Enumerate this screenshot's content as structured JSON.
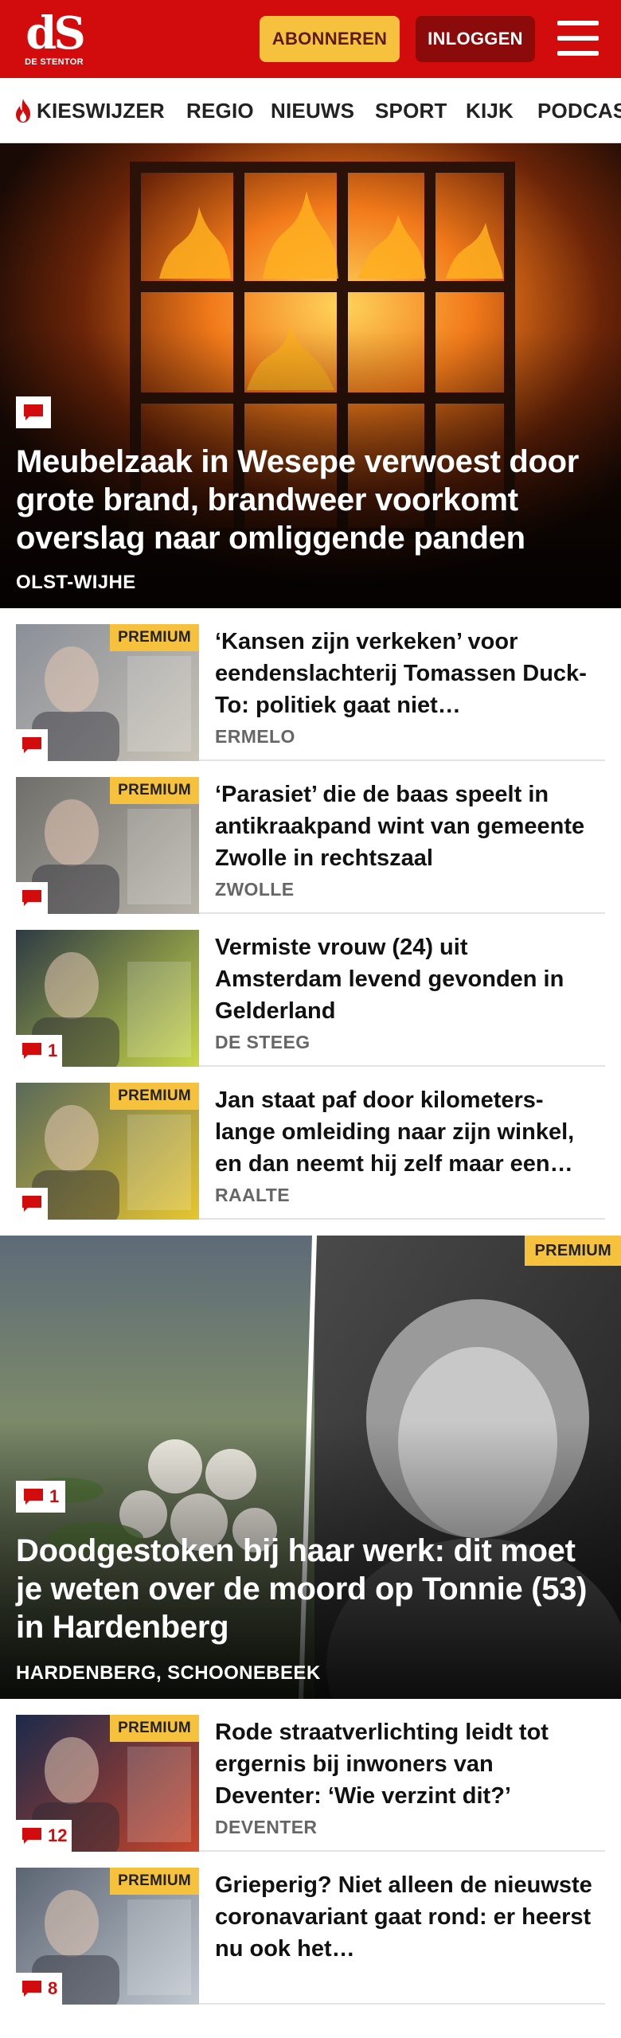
{
  "header": {
    "logo_mark": "dS",
    "logo_sub": "DE STENTOR",
    "subscribe_label": "ABONNEREN",
    "login_label": "INLOGGEN",
    "brand_color": "#d20c0c",
    "accent_color": "#f6c23e"
  },
  "nav": {
    "items": [
      {
        "label": "KIESWIJZER",
        "icon": "flame-icon"
      },
      {
        "label": "REGIO"
      },
      {
        "label": "NIEUWS"
      },
      {
        "label": "SPORT"
      },
      {
        "label": "KIJK"
      },
      {
        "label": "PODCASTS"
      }
    ]
  },
  "hero1": {
    "title": "Meubelzaak in Wesepe verwoest door grote brand, brandweer voorkomt overslag naar omliggende panden",
    "location": "OLST-WIJHE",
    "comment_count": ""
  },
  "list1": [
    {
      "title": "‘Kansen zijn verkeken’ voor eendenslachterij Tomassen Duck-To: politiek gaat niet…",
      "location": "ERMELO",
      "premium": "PREMIUM",
      "comments": ""
    },
    {
      "title": "‘Parasiet’ die de baas speelt in antikraakpand wint van gemeente Zwolle in rechtszaal",
      "location": "ZWOLLE",
      "premium": "PREMIUM",
      "comments": ""
    },
    {
      "title": "Vermiste vrouw (24) uit Amsterdam levend gevonden in Gelderland",
      "location": "DE STEEG",
      "premium": "",
      "comments": "1"
    },
    {
      "title": "Jan staat paf door kilometers-lange omleiding naar zijn winkel, en dan neemt hij zelf maar een…",
      "location": "RAALTE",
      "premium": "PREMIUM",
      "comments": ""
    }
  ],
  "hero2": {
    "title": "Doodgestoken bij haar werk: dit moet je weten over de moord op Tonnie (53) in Hardenberg",
    "location": "HARDENBERG, SCHOONEBEEK",
    "premium": "PREMIUM",
    "comment_count": "1"
  },
  "list2": [
    {
      "title": "Rode straatverlichting leidt tot ergernis bij inwoners van Deventer: ‘Wie verzint dit?’",
      "location": "DEVENTER",
      "premium": "PREMIUM",
      "comments": "12"
    },
    {
      "title": "Grieperig? Niet alleen de nieuwste coronavariant gaat rond: er heerst nu ook het…",
      "location": "",
      "premium": "PREMIUM",
      "comments": "8"
    }
  ]
}
